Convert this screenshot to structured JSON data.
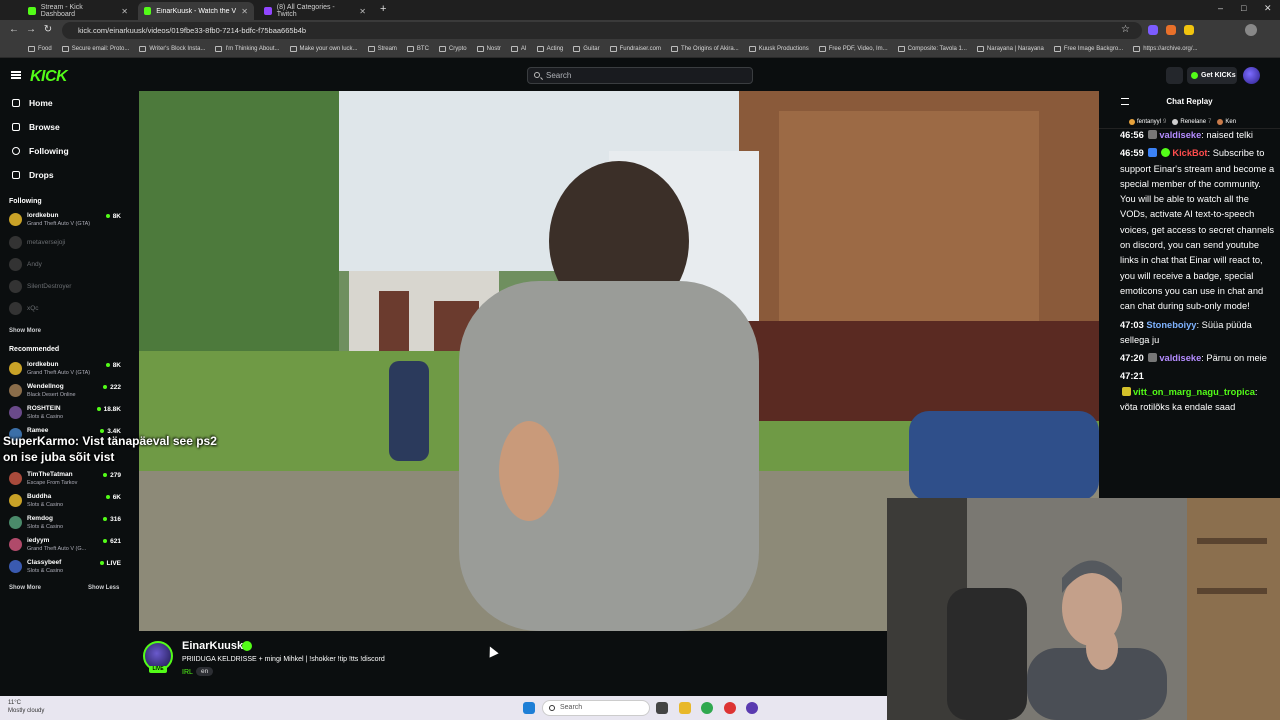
{
  "browser": {
    "tabs": [
      {
        "title": "Stream - Kick Dashboard",
        "active": false,
        "close": "✕"
      },
      {
        "title": "EinarKuusk - Watch the VOD",
        "active": true,
        "close": "✕"
      },
      {
        "title": "(8) All Categories - Twitch",
        "active": false,
        "close": "✕"
      }
    ],
    "new_tab": "+",
    "url": "kick.com/einarkuusk/videos/019fbe33-8fb0-7214-bdfc-f75baa665b4b",
    "window_controls": {
      "minimize": "–",
      "maximize": "□",
      "close": "✕"
    },
    "bookmarks": [
      "Food",
      "Secure email: Proto...",
      "Writer's Block Insta...",
      "I'm Thinking About...",
      "Make your own luck...",
      "Stream",
      "BTC",
      "Crypto",
      "Nostr",
      "AI",
      "Acting",
      "Guitar",
      "Fundraiser.com",
      "The Origins of Akira...",
      "Kuusk Productions",
      "Free PDF, Video, Im...",
      "Composite: Tavola 1...",
      "Narayana | Narayana",
      "Free Image Backgro...",
      "https://archive.org/..."
    ]
  },
  "header": {
    "logo": "KICK",
    "search_placeholder": "Search",
    "get_kicks": "Get KICKs"
  },
  "sidebar": {
    "nav": [
      {
        "label": "Home",
        "icon": "home-icon"
      },
      {
        "label": "Browse",
        "icon": "browse-icon"
      },
      {
        "label": "Following",
        "icon": "heart-icon"
      },
      {
        "label": "Drops",
        "icon": "drops-icon"
      }
    ],
    "following_title": "Following",
    "following": [
      {
        "name": "lordkebun",
        "game": "Grand Theft Auto V (GTA)",
        "viewers": "8K",
        "live": true
      },
      {
        "name": "metaversejoji",
        "game": "",
        "viewers": "",
        "live": false
      },
      {
        "name": "Andy",
        "game": "",
        "viewers": "",
        "live": false
      },
      {
        "name": "SilentDestroyer",
        "game": "",
        "viewers": "",
        "live": false
      },
      {
        "name": "xQc",
        "game": "",
        "viewers": "",
        "live": false
      }
    ],
    "show_more": "Show More",
    "recommended_title": "Recommended",
    "recommended": [
      {
        "name": "lordkebun",
        "game": "Grand Theft Auto V (GTA)",
        "viewers": "8K"
      },
      {
        "name": "Wendellnog",
        "game": "Black Desert Online",
        "viewers": "222"
      },
      {
        "name": "ROSHTEIN",
        "game": "Slots & Casino",
        "viewers": "18.8K"
      },
      {
        "name": "Ramee",
        "game": "",
        "viewers": "3.4K"
      },
      {
        "name": "TimTheTatman",
        "game": "Escape From Tarkov",
        "viewers": "279"
      },
      {
        "name": "Buddha",
        "game": "Slots & Casino",
        "viewers": "6K"
      },
      {
        "name": "Remdog",
        "game": "Slots & Casino",
        "viewers": "316"
      },
      {
        "name": "iedyym",
        "game": "Grand Theft Auto V (G...",
        "viewers": "621"
      },
      {
        "name": "Classybeef",
        "game": "Slots & Casino",
        "viewers": "LIVE"
      }
    ],
    "show_more_2": "Show More",
    "show_less": "Show Less"
  },
  "video_overlay_chat": "SuperKarmo: Vist tänapäeval see ps2 on ise juba sõit vist",
  "channel": {
    "name": "EinarKuusk",
    "title": "PRIIDUGA KELDRISSE + mingi Mihkel | !shokker !tip !tts !discord",
    "category": "IRL",
    "language": "en",
    "live_badge": "LIVE"
  },
  "chat": {
    "title": "Chat Replay",
    "leaderboard": [
      {
        "name": "fentanyyl",
        "count": "9",
        "color": "#e8a33c"
      },
      {
        "name": "Renelane",
        "count": "7",
        "color": "#cfcfcf"
      },
      {
        "name": "Ken",
        "count": "",
        "color": "#c97b4a"
      }
    ],
    "messages": [
      {
        "time": "46:56",
        "user": "valdiseke",
        "color": "#b48cff",
        "text": "naised telki"
      },
      {
        "time": "46:59",
        "user": "KickBot",
        "color": "#ff4d4d",
        "text": "Subscribe to support Einar's stream and become a special member of the community. You will be able to watch all the VODs, activate AI text-to-speech voices, get access to secret channels on discord, you can send youtube links in chat that Einar will react to, you will receive a badge, special emoticons you can use in chat and can chat during sub-only mode!"
      },
      {
        "time": "47:03",
        "user": "Stoneboiyy",
        "color": "#7fb3ff",
        "text": "Süüa püüda sellega ju"
      },
      {
        "time": "47:20",
        "user": "valdiseke",
        "color": "#b48cff",
        "text": "Pärnu on meie"
      },
      {
        "time": "47:21",
        "user": "vitt_on_marg_nagu_tropica",
        "color": "#53fc18",
        "text": "võta rotilõks ka endale saad"
      }
    ]
  },
  "taskbar": {
    "weather_temp": "11°C",
    "weather_desc": "Mostly cloudy",
    "search": "Search"
  },
  "colors": {
    "accent": "#53fc18",
    "background": "#0b0e0f"
  }
}
